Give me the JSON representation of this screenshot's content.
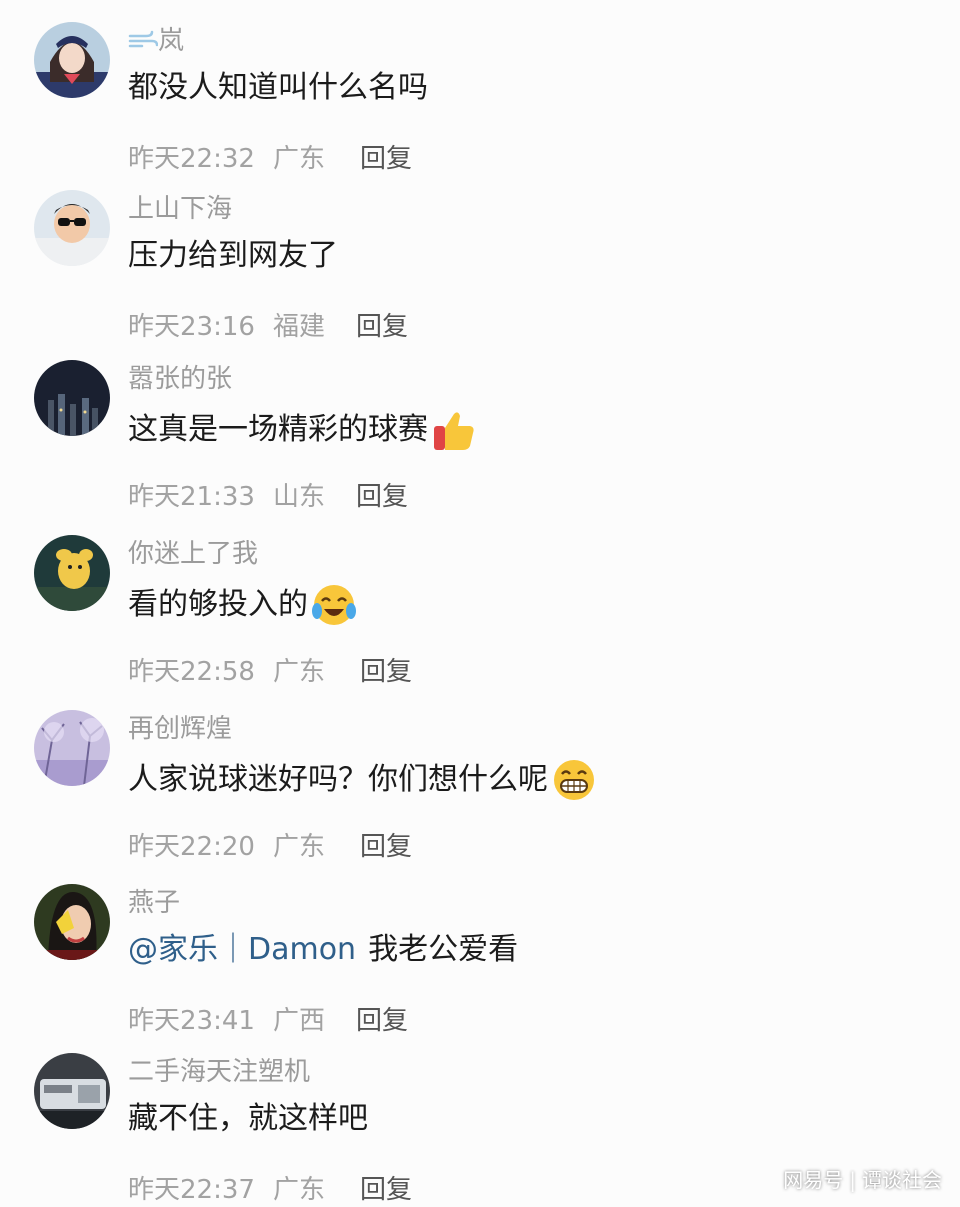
{
  "comments": [
    {
      "username": "岚",
      "username_prefix_icon": "wind-icon",
      "text": "都没人知道叫什么名吗",
      "time": "昨天22:32",
      "location": "广东",
      "reply": "回复"
    },
    {
      "username": "上山下海",
      "text": "压力给到网友了",
      "time": "昨天23:16",
      "location": "福建",
      "reply": "回复"
    },
    {
      "username": "嚣张的张",
      "text": "这真是一场精彩的球赛",
      "emoji": "thumbs-up-emoji",
      "time": "昨天21:33",
      "location": "山东",
      "reply": "回复"
    },
    {
      "username": "你迷上了我",
      "text": "看的够投入的",
      "emoji": "tears-of-joy-emoji",
      "time": "昨天22:58",
      "location": "广东",
      "reply": "回复"
    },
    {
      "username": "再创辉煌",
      "text": "人家说球迷好吗？你们想什么呢",
      "emoji": "grinning-face-emoji",
      "time": "昨天22:20",
      "location": "广东",
      "reply": "回复"
    },
    {
      "username": "燕子",
      "mention": "@家乐｜Damon",
      "text": "我老公爱看",
      "time": "昨天23:41",
      "location": "广西",
      "reply": "回复"
    },
    {
      "username": "二手海天注塑机",
      "text": "藏不住，就这样吧",
      "time": "昨天22:37",
      "location": "广东",
      "reply": "回复"
    }
  ],
  "watermark": {
    "brand": "网易号",
    "author": "谭谈社会"
  }
}
